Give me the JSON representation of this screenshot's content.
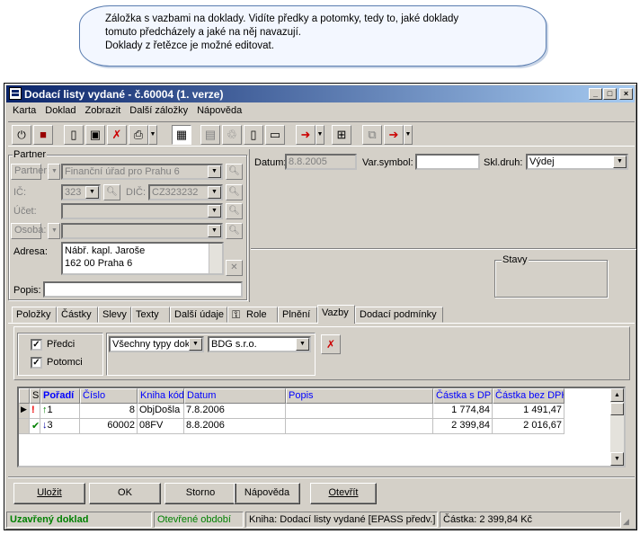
{
  "callout": {
    "line1": "Záložka s vazbami na doklady. Vidíte předky a potomky, tedy to, jaké doklady",
    "line2": "tomuto předcházely a jaké na něj navazují.",
    "line3": "Doklady z řetězce je možné editovat."
  },
  "window": {
    "title": "Dodací listy vydané - č.60004 (1. verze)",
    "min": "_",
    "max": "□",
    "close": "×"
  },
  "menu": [
    "Karta",
    "Doklad",
    "Zobrazit",
    "Další záložky",
    "Nápověda"
  ],
  "partner": {
    "legend": "Partner",
    "partner_label": "Partner:",
    "partner_value": "Finanční úřad pro Prahu 6",
    "ic_label": "IČ:",
    "ic_value": "323",
    "dic_label": "DIČ:",
    "dic_value": "CZ323232",
    "ucet_label": "Účet:",
    "osoba_label": "Osoba:",
    "adresa_label": "Adresa:",
    "adresa_line1": "Nábř. kapl. Jaroše",
    "adresa_line2": "162 00 Praha 6",
    "popis_label": "Popis:"
  },
  "header": {
    "datum_label": "Datum:",
    "datum_value": "8.8.2005",
    "varsym_label": "Var.symbol:",
    "varsym_value": "",
    "skldruh_label": "Skl.druh:",
    "skldruh_value": "Výdej",
    "stavy_label": "Stavy"
  },
  "tabs": [
    "Položky",
    "Částky",
    "Slevy",
    "Texty",
    "Další údaje",
    "Role",
    "Plnění",
    "Vazby",
    "Dodací podmínky"
  ],
  "vazby": {
    "predci": "Předci",
    "potomci": "Potomci",
    "type_filter": "Všechny typy dok",
    "firm_filter": "BDG s.r.o."
  },
  "grid": {
    "columns": [
      "S",
      "Pořadí",
      "Číslo",
      "Kniha kód",
      "Datum",
      "Popis",
      "Částka s DPH",
      "Částka bez DPH"
    ],
    "rows": [
      {
        "status": "!",
        "direction": "↑",
        "poradi": "1",
        "cislo": "8",
        "kniha": "ObjDošla",
        "datum": "7.8.2006",
        "popis": "",
        "castka_dph": "1 774,84",
        "castka_bez": "1 491,47"
      },
      {
        "status": "✔",
        "direction": "↓",
        "poradi": "3",
        "cislo": "60002",
        "kniha": "08FV",
        "datum": "8.8.2006",
        "popis": "",
        "castka_dph": "2 399,84",
        "castka_bez": "2 016,67"
      }
    ]
  },
  "buttons": {
    "ulozit": "Uložit",
    "ok": "OK",
    "storno": "Storno",
    "napoveda": "Nápověda",
    "otevrit": "Otevřít"
  },
  "status": {
    "doc_state": "Uzavřený doklad",
    "period": "Otevřené období",
    "book": "Kniha: Dodací listy vydané [EPASS předv.]",
    "amount": "Částka: 2 399,84 Kč"
  },
  "colors": {
    "title_start": "#0a246a",
    "title_end": "#a6caf0",
    "status_green": "#008000",
    "header_blue": "#0000ff"
  }
}
